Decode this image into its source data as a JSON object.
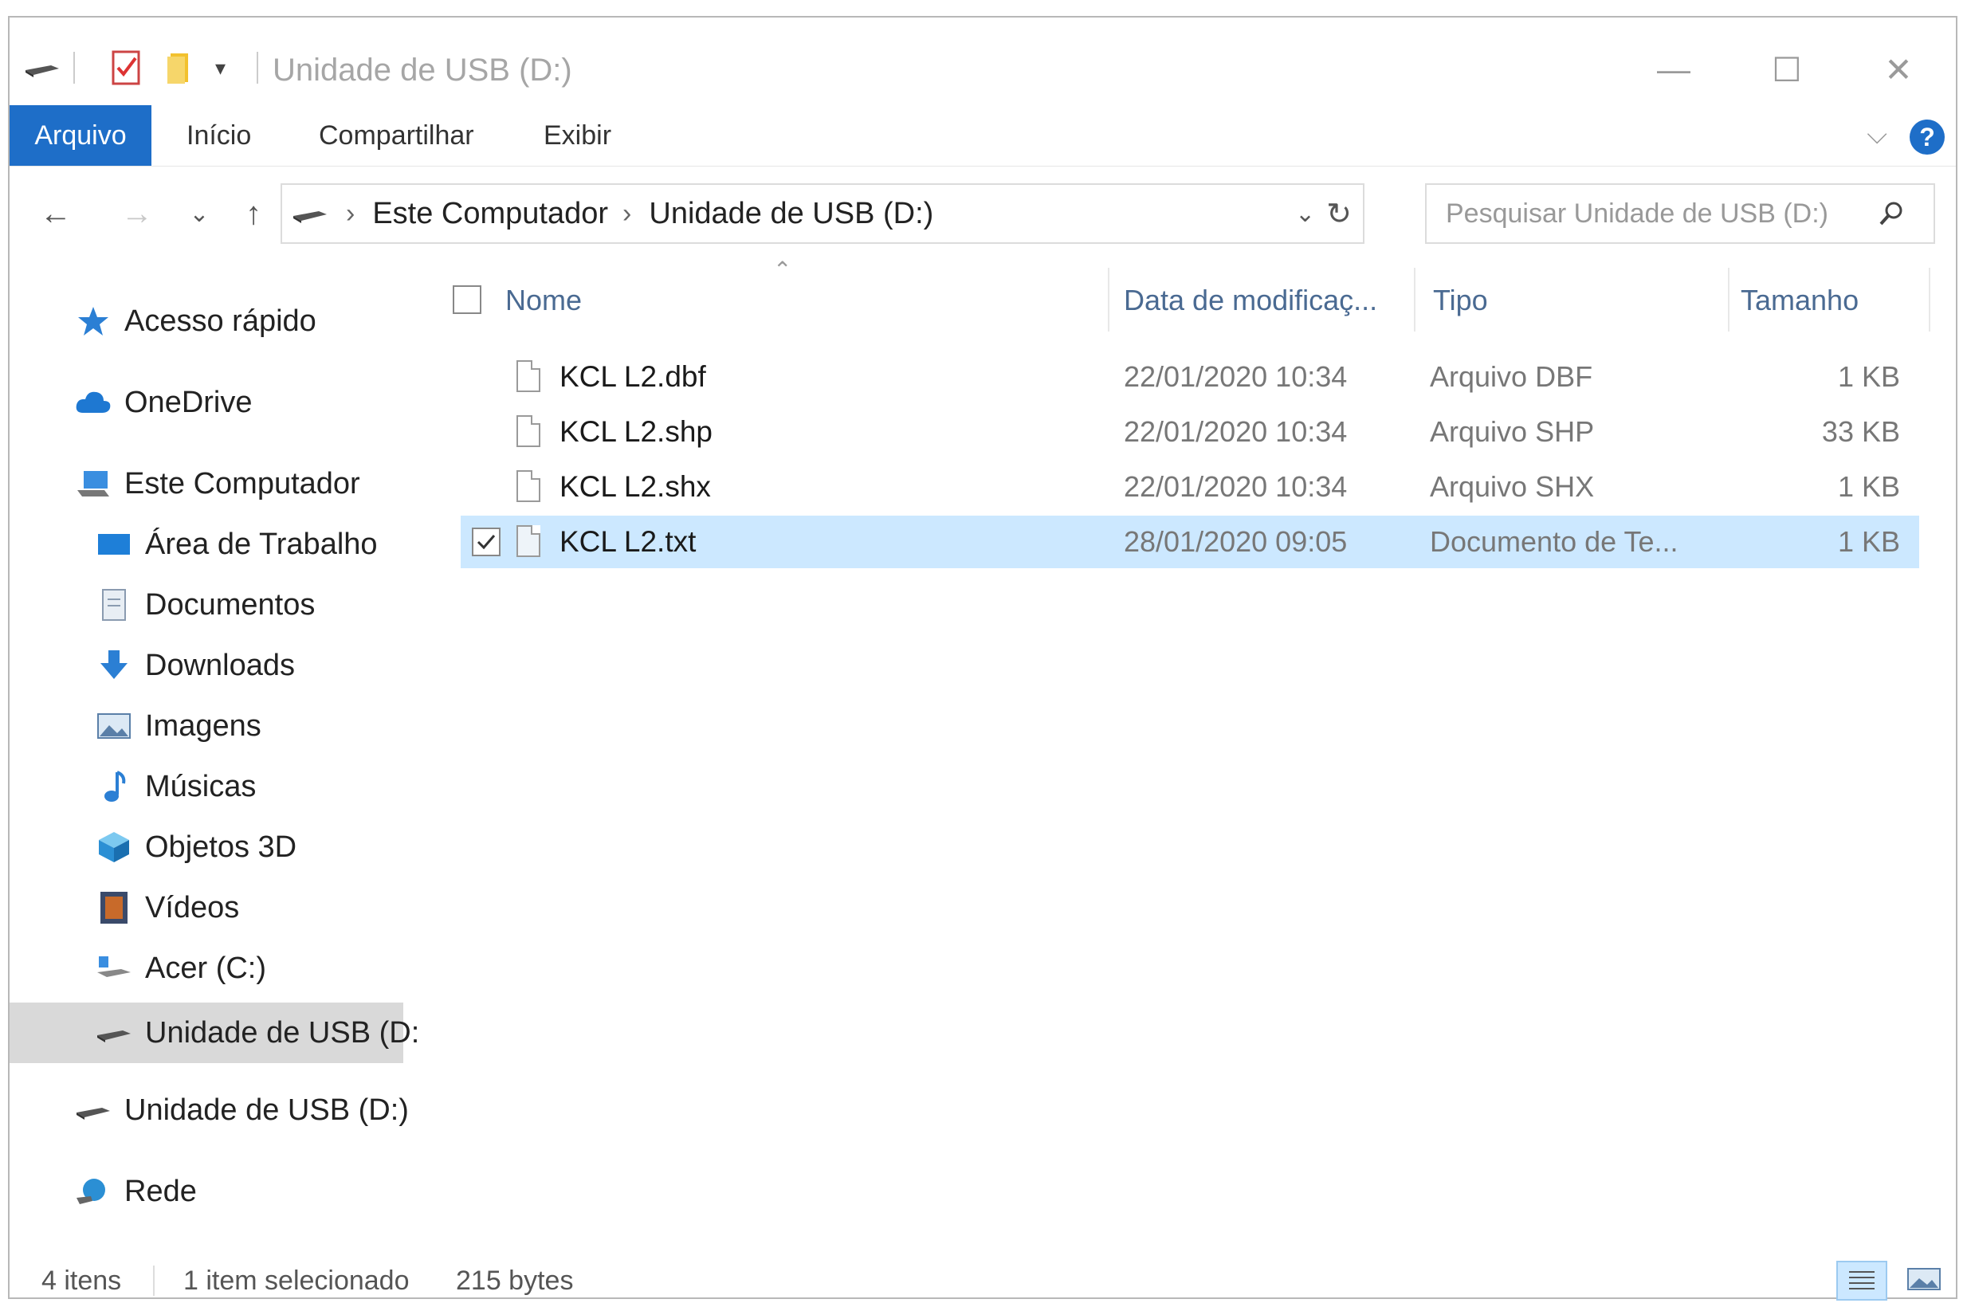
{
  "window": {
    "title": "Unidade de USB (D:)",
    "minimize": "—",
    "maximize": "☐",
    "close": "✕"
  },
  "ribbon": {
    "tabs": [
      "Arquivo",
      "Início",
      "Compartilhar",
      "Exibir"
    ],
    "help": "?",
    "collapse": "⌵"
  },
  "nav": {
    "back": "←",
    "forward": "→",
    "recent": "⌄",
    "up": "↑",
    "breadcrumb": [
      "Este Computador",
      "Unidade de USB (D:)"
    ],
    "separator": "›",
    "dropdown": "⌄",
    "refresh": "↻",
    "search_placeholder": "Pesquisar Unidade de USB (D:)"
  },
  "sidebar": {
    "items": [
      {
        "label": "Acesso rápido",
        "icon": "star-icon"
      },
      {
        "label": "OneDrive",
        "icon": "cloud-icon"
      },
      {
        "label": "Este Computador",
        "icon": "computer-icon"
      },
      {
        "label": "Área de Trabalho",
        "icon": "desktop-icon"
      },
      {
        "label": "Documentos",
        "icon": "documents-icon"
      },
      {
        "label": "Downloads",
        "icon": "download-icon"
      },
      {
        "label": "Imagens",
        "icon": "pictures-icon"
      },
      {
        "label": "Músicas",
        "icon": "music-icon"
      },
      {
        "label": "Objetos 3D",
        "icon": "cube-icon"
      },
      {
        "label": "Vídeos",
        "icon": "video-icon"
      },
      {
        "label": "Acer (C:)",
        "icon": "drive-icon"
      },
      {
        "label": "Unidade de USB (D:",
        "icon": "usb-drive-icon"
      },
      {
        "label": "Unidade de USB (D:)",
        "icon": "usb-drive-icon"
      },
      {
        "label": "Rede",
        "icon": "network-icon"
      }
    ]
  },
  "columns": {
    "name": "Nome",
    "date": "Data de modificaç...",
    "type": "Tipo",
    "size": "Tamanho"
  },
  "files": [
    {
      "name": "KCL L2.dbf",
      "date": "22/01/2020 10:34",
      "type": "Arquivo DBF",
      "size": "1 KB",
      "selected": false
    },
    {
      "name": "KCL L2.shp",
      "date": "22/01/2020 10:34",
      "type": "Arquivo SHP",
      "size": "33 KB",
      "selected": false
    },
    {
      "name": "KCL L2.shx",
      "date": "22/01/2020 10:34",
      "type": "Arquivo SHX",
      "size": "1 KB",
      "selected": false
    },
    {
      "name": "KCL L2.txt",
      "date": "28/01/2020 09:05",
      "type": "Documento de Te...",
      "size": "1 KB",
      "selected": true
    }
  ],
  "status": {
    "count": "4 itens",
    "selection": "1 item selecionado",
    "bytes": "215 bytes"
  },
  "colors": {
    "accent": "#1e6ec8",
    "selection": "#cce8ff",
    "header_text": "#4a6a92"
  }
}
